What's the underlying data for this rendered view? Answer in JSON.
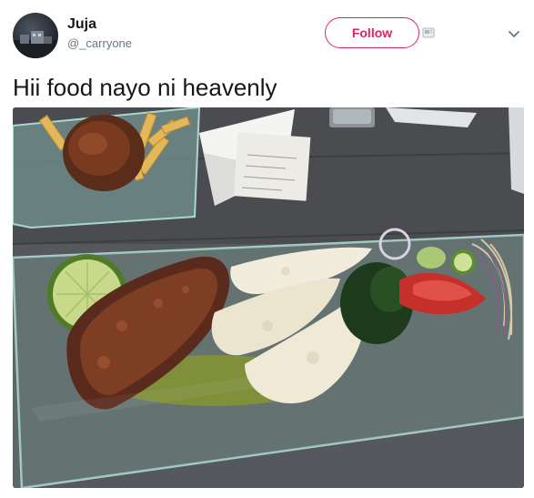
{
  "user": {
    "display_name": "Juja",
    "handle": "@_carryone"
  },
  "actions": {
    "follow_label": "Follow"
  },
  "tweet": {
    "text": "Hii food nayo ni heavenly"
  },
  "icons": {
    "badge": "badge-icon",
    "more": "chevron-down-icon"
  },
  "colors": {
    "accent": "#e0245e",
    "text": "#14171a",
    "secondary": "#657786"
  }
}
